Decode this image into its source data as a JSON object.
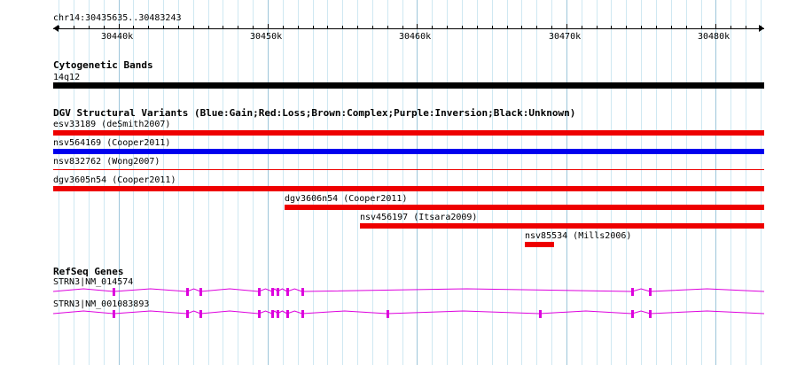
{
  "view": {
    "start": 30435635,
    "end": 30483243
  },
  "colors": {
    "grid": "#cfe8f2",
    "grid_major": "#9dc6da",
    "band": "#000000",
    "gain": "#0000ee",
    "loss": "#ee0000",
    "gene": "#dd00dd"
  },
  "ruler": {
    "location": "chr14:30435635..30483243",
    "ticks": [
      {
        "pos": 30440000,
        "label": "30440k"
      },
      {
        "pos": 30450000,
        "label": "30450k"
      },
      {
        "pos": 30460000,
        "label": "30460k"
      },
      {
        "pos": 30470000,
        "label": "30470k"
      },
      {
        "pos": 30480000,
        "label": "30480k"
      }
    ]
  },
  "cytobands": {
    "title": "Cytogenetic Bands",
    "band_label": "14q12"
  },
  "dgv": {
    "title": "DGV Structural Variants (Blue:Gain;Red:Loss;Brown:Complex;Purple:Inversion;Black:Unknown)",
    "variants": [
      {
        "label": "esv33189 (deSmith2007)",
        "start": 30435635,
        "end": 30483243,
        "type": "loss",
        "thick": true
      },
      {
        "label": "nsv564169 (Cooper2011)",
        "start": 30435635,
        "end": 30483243,
        "type": "gain",
        "thick": true
      },
      {
        "label": "nsv832762 (Wong2007)",
        "start": 30435635,
        "end": 30483243,
        "type": "loss",
        "thick": false
      },
      {
        "label": "dgv3605n54 (Cooper2011)",
        "start": 30435635,
        "end": 30483243,
        "type": "loss",
        "thick": true
      },
      {
        "label": "dgv3606n54 (Cooper2011)",
        "start": 30451100,
        "end": 30483243,
        "type": "loss",
        "thick": true
      },
      {
        "label": "nsv456197 (Itsara2009)",
        "start": 30456200,
        "end": 30483243,
        "type": "loss",
        "thick": true
      },
      {
        "label": "nsv85534 (Mills2006)",
        "start": 30467200,
        "end": 30469200,
        "type": "loss",
        "thick": true
      }
    ]
  },
  "refseq": {
    "title": "RefSeq Genes",
    "transcripts": [
      {
        "label": "STRN3|NM_014574",
        "exons": [
          30439700,
          30444600,
          30445500,
          30449400,
          30450300,
          30450650,
          30451300,
          30452300,
          30474400,
          30475600
        ]
      },
      {
        "label": "STRN3|NM_001083893",
        "exons": [
          30439700,
          30444600,
          30445500,
          30449400,
          30450300,
          30450650,
          30451300,
          30452300,
          30458000,
          30468200,
          30474400,
          30475600
        ]
      }
    ]
  }
}
